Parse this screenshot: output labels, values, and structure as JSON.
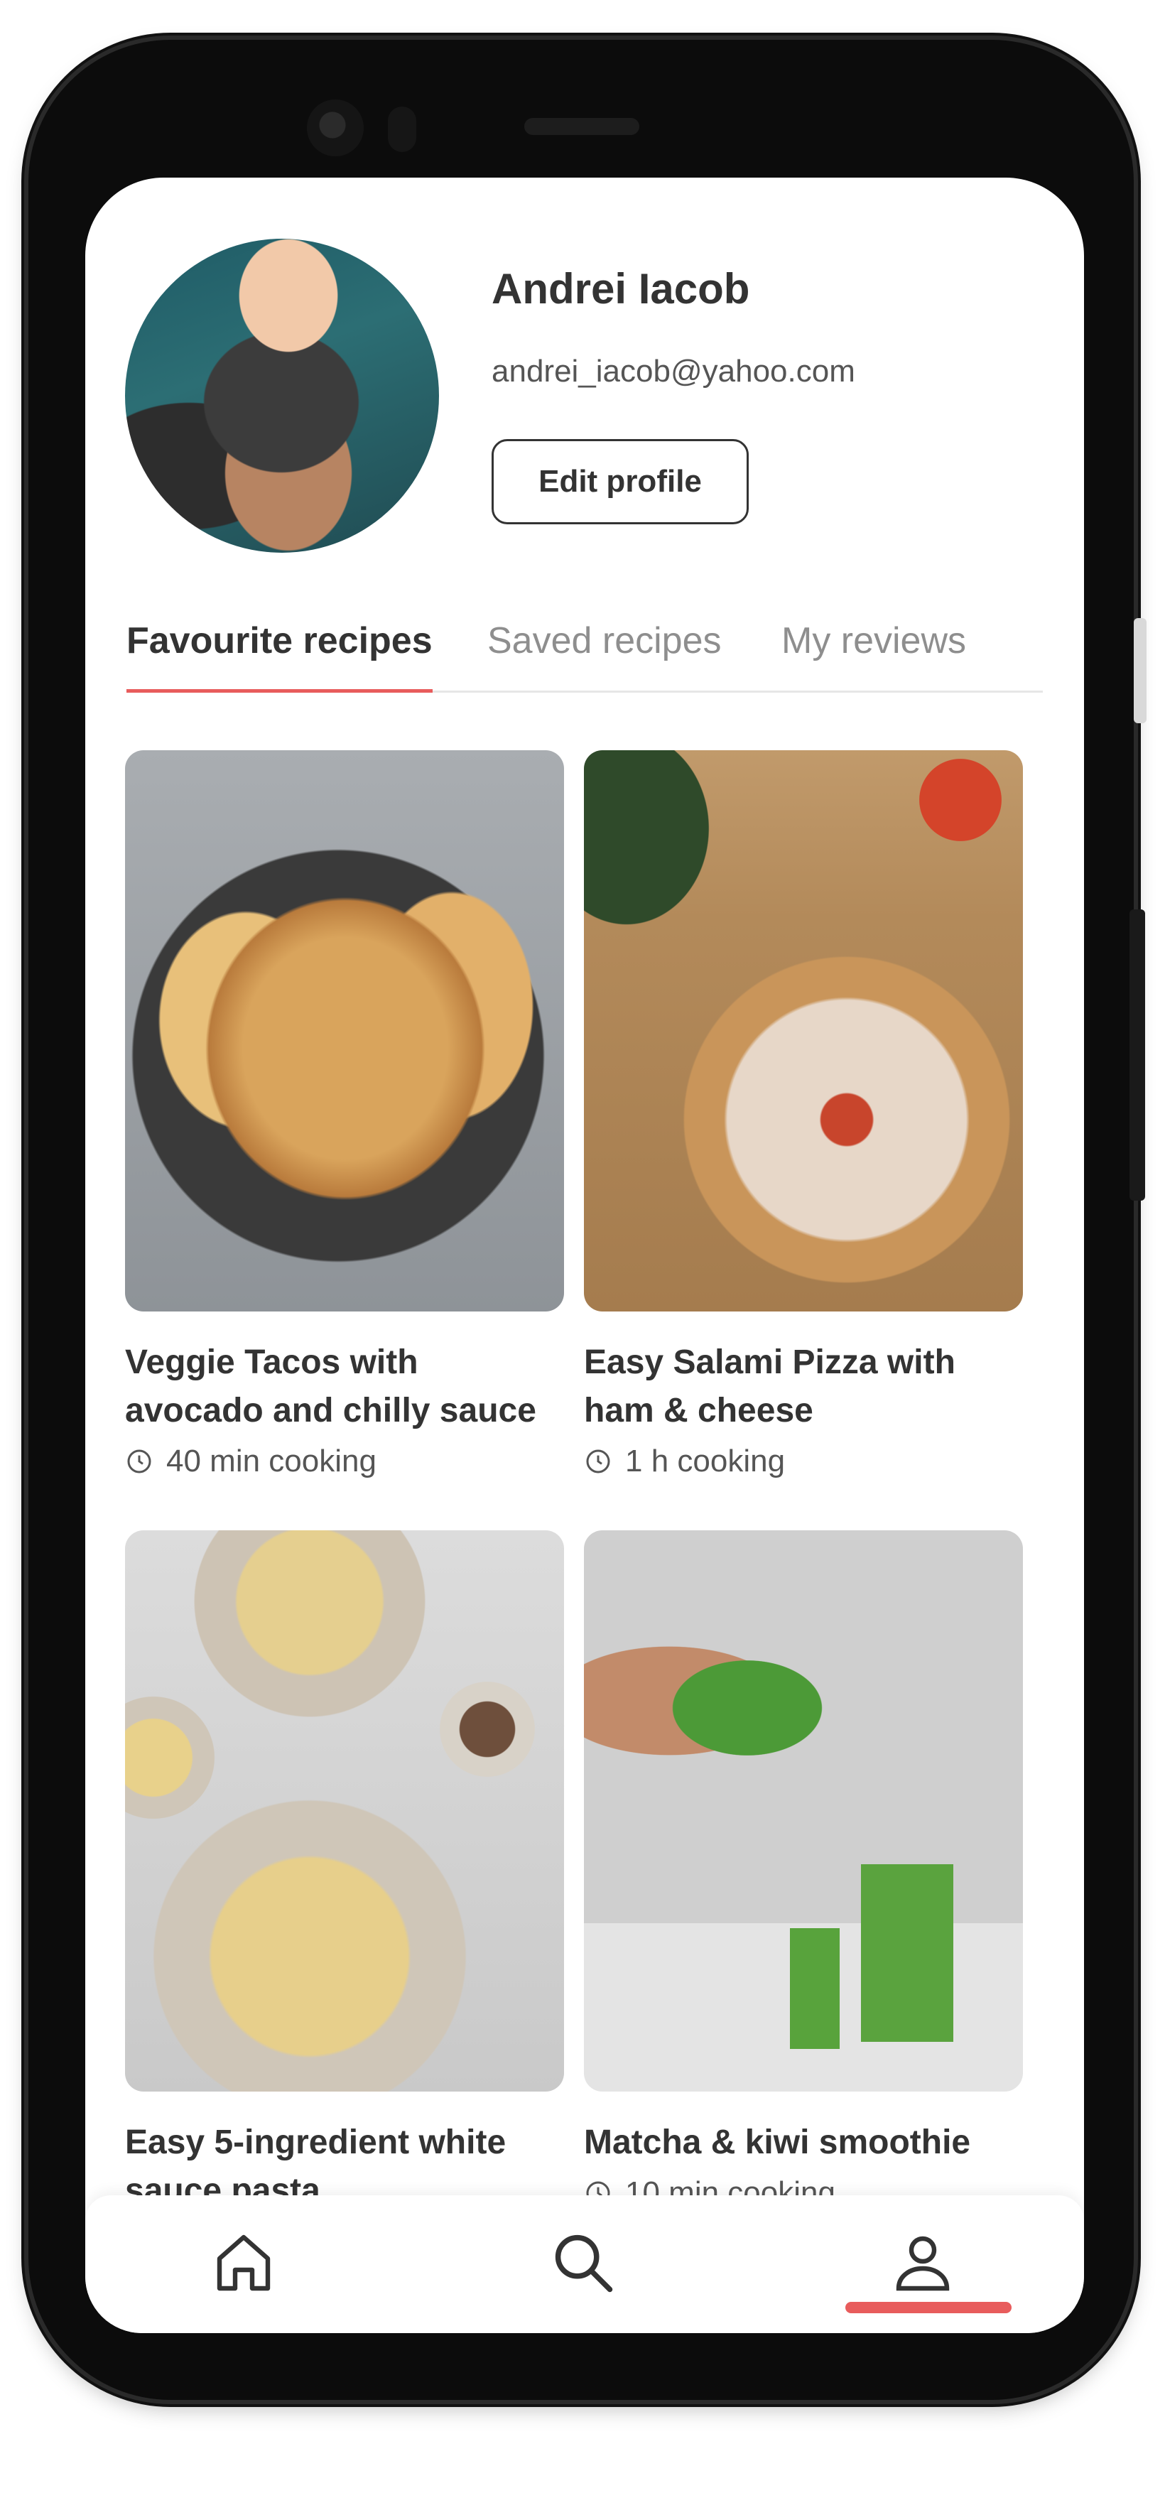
{
  "profile": {
    "name": "Andrei Iacob",
    "email": "andrei_iacob@yahoo.com",
    "edit_label": "Edit profile"
  },
  "tabs": [
    {
      "label": "Favourite recipes",
      "active": true
    },
    {
      "label": "Saved recipes",
      "active": false
    },
    {
      "label": "My reviews",
      "active": false
    }
  ],
  "recipes": [
    {
      "title": "Veggie Tacos with avocado and chilly sauce",
      "time": "40 min cooking"
    },
    {
      "title": "Easy Salami Pizza with ham & cheese",
      "time": "1 h cooking"
    },
    {
      "title": "Easy 5-ingredient white sauce pasta",
      "time": ""
    },
    {
      "title": "Matcha & kiwi smoothie",
      "time": "10 min cooking"
    }
  ],
  "nav": {
    "items": [
      {
        "icon": "home-icon",
        "active": false
      },
      {
        "icon": "search-icon",
        "active": false
      },
      {
        "icon": "user-icon",
        "active": true
      }
    ]
  },
  "colors": {
    "accent": "#e85c5c",
    "text": "#333333",
    "muted": "#8e8e8e"
  }
}
